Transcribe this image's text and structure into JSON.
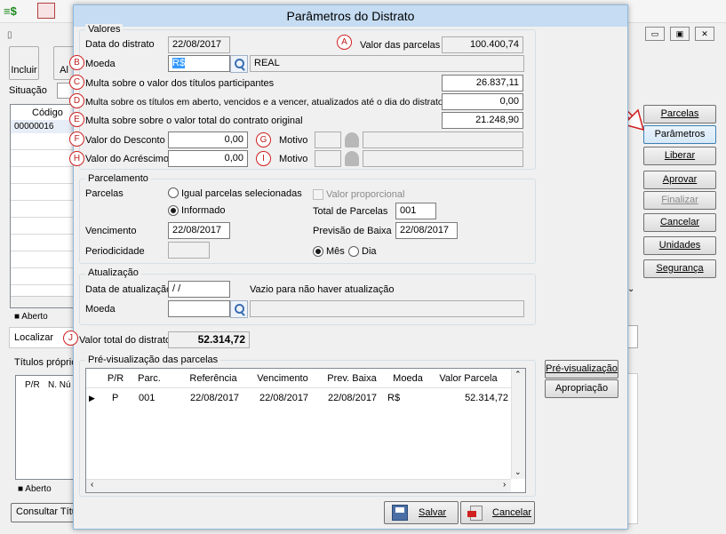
{
  "background": {
    "toolbar": {
      "incluir_label": "Incluir",
      "alterar_partial": "Al"
    },
    "situacao_label": "Situação",
    "grid": {
      "codigo_header": "Código",
      "codigo_value": "00000016"
    },
    "aberto_label": "Aberto",
    "localizar_label": "Localizar",
    "titulos_proprios_label": "Títulos próprios",
    "sub_grid_headers": [
      "P/R",
      "N. Nú"
    ],
    "aberto_label_2": "Aberto",
    "consultar_label": "Consultar Títul",
    "side_buttons": [
      "Parcelas",
      "Parâmetros",
      "Liberar",
      "Aprovar",
      "Finalizar",
      "Cancelar",
      "Unidades",
      "Segurança"
    ]
  },
  "dialog": {
    "title": "Parâmetros do Distrato",
    "valores": {
      "group_label": "Valores",
      "data_distrato_label": "Data do distrato",
      "data_distrato": "22/08/2017",
      "valor_parcelas_label": "Valor das parcelas",
      "valor_parcelas": "100.400,74",
      "moeda_label": "Moeda",
      "moeda_code": "R$",
      "moeda_desc": "REAL",
      "multa_participantes_label": "Multa sobre o valor dos títulos participantes",
      "multa_participantes": "26.837,11",
      "multa_aberto_label": "Multa sobre os títulos em aberto, vencidos e a vencer, atualizados até o dia do distrato",
      "multa_aberto": "0,00",
      "multa_contrato_label": "Multa sobre sobre o valor total do contrato original",
      "multa_contrato": "21.248,90",
      "desconto_label": "Valor do Desconto",
      "desconto": "0,00",
      "acrescimo_label": "Valor do Acréscimo",
      "acrescimo": "0,00",
      "motivo_label": "Motivo"
    },
    "markers": [
      "A",
      "B",
      "C",
      "D",
      "E",
      "F",
      "G",
      "H",
      "I",
      "J"
    ],
    "parcelamento": {
      "group_label": "Parcelamento",
      "parcelas_label": "Parcelas",
      "opt_igual": "Igual parcelas selecionadas",
      "opt_informado": "Informado",
      "valor_proporcional": "Valor proporcional",
      "total_parcelas_label": "Total de Parcelas",
      "total_parcelas": "001",
      "vencimento_label": "Vencimento",
      "vencimento": "22/08/2017",
      "previsao_label": "Previsão de Baixa",
      "previsao": "22/08/2017",
      "periodicidade_label": "Periodicidade",
      "opt_mes": "Mês",
      "opt_dia": "Dia"
    },
    "atualizacao": {
      "group_label": "Atualização",
      "data_label": "Data de atualização",
      "data_value": " / /",
      "hint": "Vazio para não haver atualização",
      "moeda_label": "Moeda"
    },
    "valor_total_label": "Valor total do distrato",
    "valor_total": "52.314,72",
    "preview": {
      "group_label": "Pré-visualização das parcelas",
      "headers": [
        "P/R",
        "Parc.",
        "Referência",
        "Vencimento",
        "Prev. Baixa",
        "Moeda",
        "Valor Parcela"
      ],
      "row": [
        "P",
        "001",
        "22/08/2017",
        "22/08/2017",
        "22/08/2017",
        "R$",
        "52.314,72"
      ]
    },
    "btn_previsualizacao": "Pré-visualização",
    "btn_apropriacao": "Apropriação",
    "btn_salvar": "Salvar",
    "btn_cancelar": "Cancelar"
  },
  "colors": {
    "dialog_border": "#8fb8dd",
    "title_bg": "#c5dcf2",
    "marker": "#d02020",
    "arrow": "#d02020"
  }
}
